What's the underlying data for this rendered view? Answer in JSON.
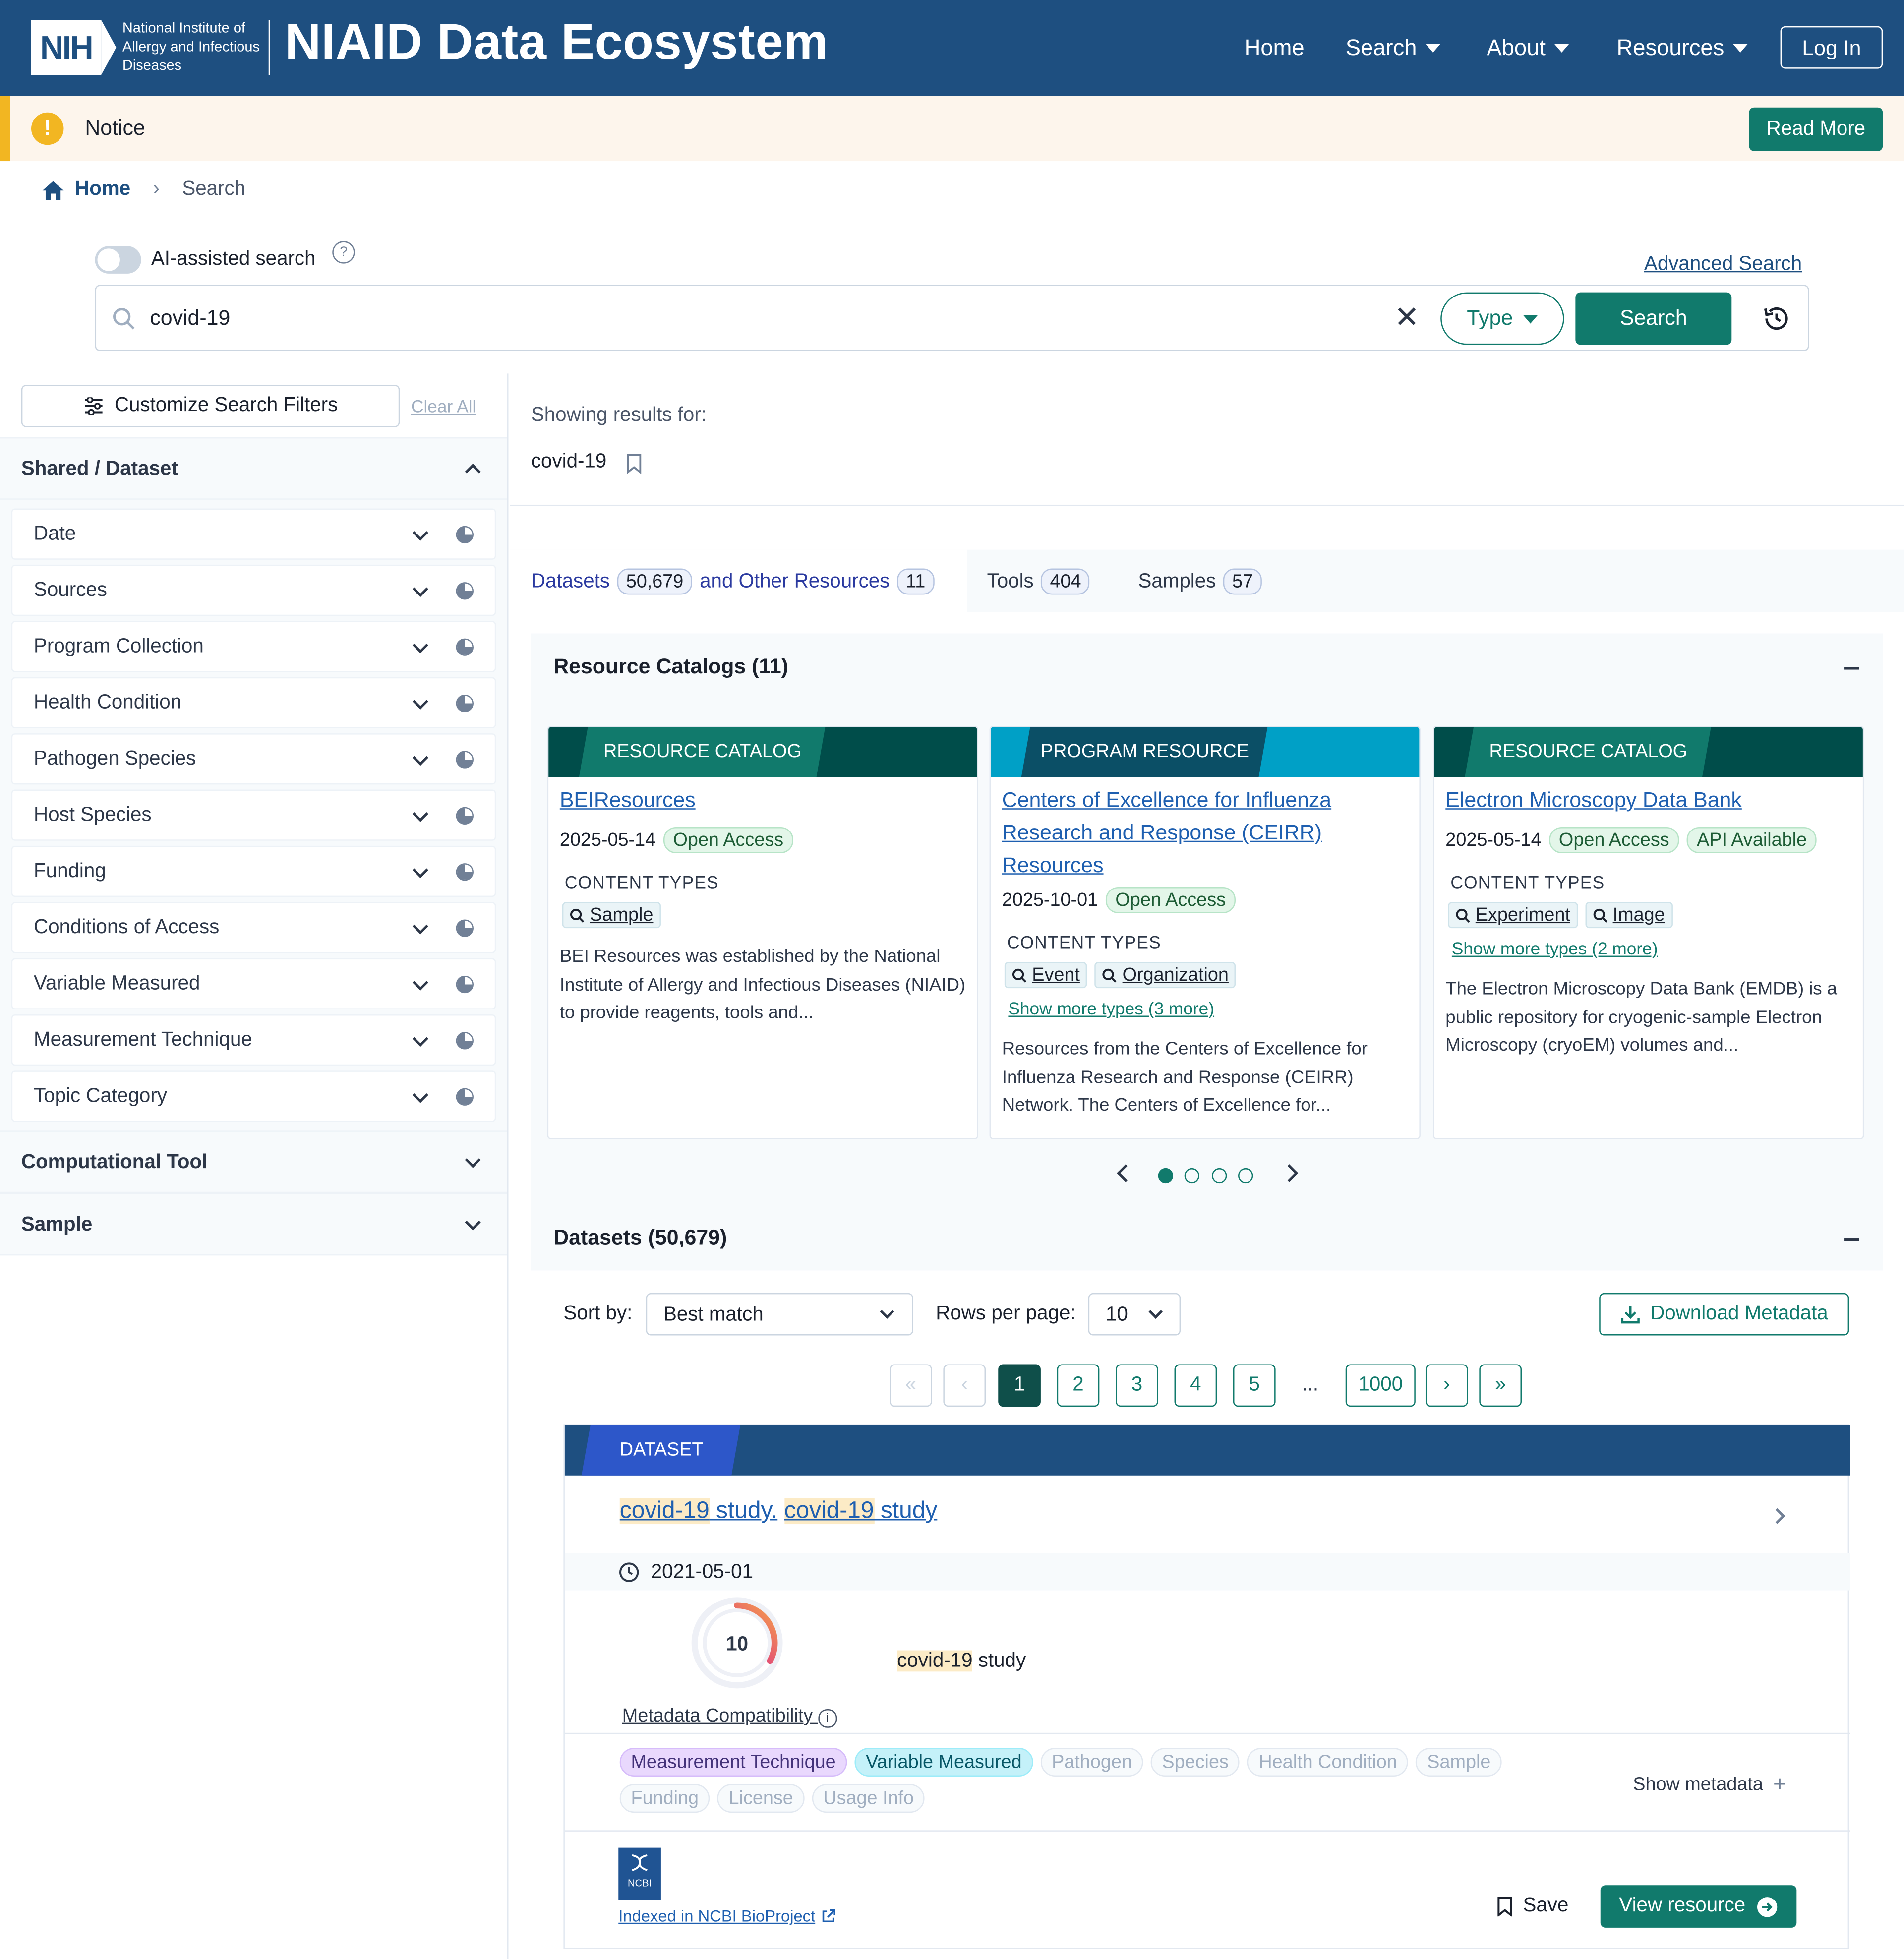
{
  "header": {
    "logo_text": "NIH",
    "institute_name": "National Institute of Allergy and Infectious Diseases",
    "site_title": "NIAID Data Ecosystem",
    "nav": [
      {
        "label": "Home"
      },
      {
        "label": "Search"
      },
      {
        "label": "About"
      },
      {
        "label": "Resources"
      }
    ],
    "login_label": "Log In"
  },
  "notice": {
    "icon": "!",
    "text": "Notice",
    "button_label": "Read More"
  },
  "breadcrumb": {
    "home": "Home",
    "current": "Search"
  },
  "search": {
    "ai_label": "AI-assisted search",
    "ai_enabled": false,
    "help_glyph": "?",
    "advanced_label": "Advanced Search",
    "query": "covid-19",
    "type_label": "Type",
    "button_label": "Search"
  },
  "sidebar": {
    "customize_label": "Customize Search Filters",
    "clear_all_label": "Clear All",
    "group_shared": "Shared / Dataset",
    "filters": [
      "Date",
      "Sources",
      "Program Collection",
      "Health Condition",
      "Pathogen Species",
      "Host Species",
      "Funding",
      "Conditions of Access",
      "Variable Measured",
      "Measurement Technique",
      "Topic Category"
    ],
    "group_tool": "Computational Tool",
    "group_sample": "Sample"
  },
  "results_for": {
    "label": "Showing results for:",
    "query": "covid-19"
  },
  "tabs": {
    "datasets_label": "Datasets",
    "datasets_count": "50,679",
    "other_label": "and Other Resources",
    "other_count": "11",
    "tools_label": "Tools",
    "tools_count": "404",
    "samples_label": "Samples",
    "samples_count": "57"
  },
  "catalogs": {
    "title": "Resource Catalogs (11)",
    "content_types_label": "CONTENT TYPES",
    "cards": [
      {
        "tag": "RESOURCE CATALOG",
        "title": "BEIResources",
        "date": "2025-05-14",
        "badges": [
          "Open Access"
        ],
        "types": [
          "Sample"
        ],
        "more": "",
        "desc": "BEI Resources was established by the National Institute of Allergy and Infectious Diseases (NIAID) to provide reagents, tools and..."
      },
      {
        "tag": "PROGRAM RESOURCE",
        "title": "Centers of Excellence for Influenza Research and Response (CEIRR) Resources",
        "date": "2025-10-01",
        "badges": [
          "Open Access"
        ],
        "types": [
          "Event",
          "Organization"
        ],
        "more": "Show more types (3 more)",
        "desc": "Resources from the Centers of Excellence for Influenza Research and Response (CEIRR) Network. The Centers of Excellence for..."
      },
      {
        "tag": "RESOURCE CATALOG",
        "title": "Electron Microscopy Data Bank",
        "date": "2025-05-14",
        "badges": [
          "Open Access",
          "API Available"
        ],
        "types": [
          "Experiment",
          "Image"
        ],
        "more": "Show more types (2 more)",
        "desc": "The Electron Microscopy Data Bank (EMDB) is a public repository for cryogenic-sample Electron Microscopy (cryoEM) volumes and..."
      }
    ],
    "carousel_pages": 4,
    "carousel_current": 1
  },
  "datasets": {
    "title": "Datasets (50,679)",
    "sort_label": "Sort by:",
    "sort_value": "Best match",
    "rows_label": "Rows per page:",
    "rows_value": "10",
    "download_label": "Download Metadata",
    "pages": [
      "1",
      "2",
      "3",
      "4",
      "5"
    ],
    "ellipsis": "...",
    "last_page": "1000",
    "current_page": "1"
  },
  "result": {
    "tag": "DATASET",
    "title_hl1": "covid-19",
    "title_txt1": " study.",
    "title_hl2": "covid-19",
    "title_txt2": " study",
    "date": "2021-05-01",
    "score": "10",
    "score_fraction": 0.33,
    "compat_label": "Metadata Compatibility",
    "desc_hl": "covid-19",
    "desc_txt": " study",
    "metadata_tags": [
      "Measurement Technique",
      "Variable Measured",
      "Pathogen",
      "Species",
      "Health Condition",
      "Sample",
      "Funding",
      "License",
      "Usage Info"
    ],
    "show_metadata_label": "Show metadata",
    "source_logo": "NCBI",
    "source_label": "Indexed in NCBI BioProject",
    "save_label": "Save",
    "view_label": "View resource"
  },
  "colors": {
    "header": "#1e4f80",
    "accent": "#117a6c",
    "notice": "#f2b622",
    "dataset_tag": "#2d57c9"
  }
}
